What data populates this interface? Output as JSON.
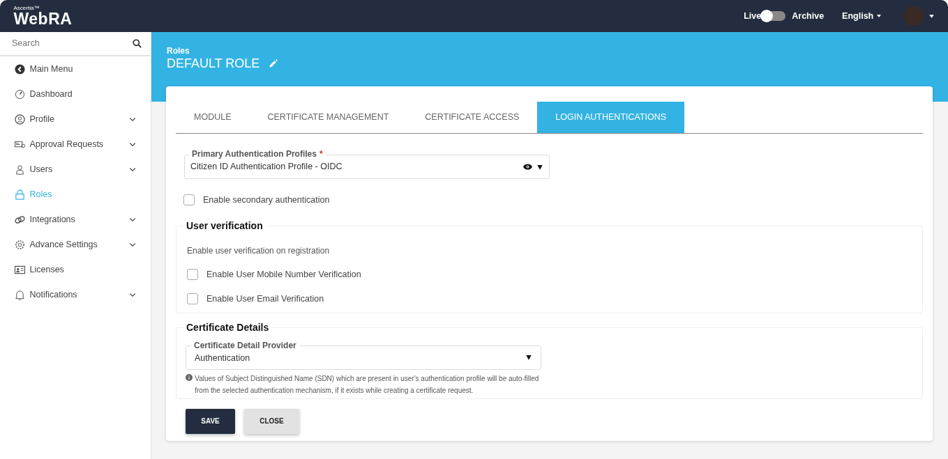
{
  "header": {
    "brand_small": "Ascertia™",
    "brand": "WebRA",
    "toggle": {
      "left_label": "Live",
      "right_label": "Archive",
      "on": false
    },
    "language": "English"
  },
  "sidebar": {
    "search": {
      "placeholder": "Search"
    },
    "items": [
      {
        "label": "Main Menu",
        "expandable": false,
        "selected": false
      },
      {
        "label": "Dashboard",
        "expandable": false,
        "selected": false
      },
      {
        "label": "Profile",
        "expandable": true,
        "selected": false
      },
      {
        "label": "Approval Requests",
        "expandable": true,
        "selected": false
      },
      {
        "label": "Users",
        "expandable": true,
        "selected": false
      },
      {
        "label": "Roles",
        "expandable": false,
        "selected": true
      },
      {
        "label": "Integrations",
        "expandable": true,
        "selected": false
      },
      {
        "label": "Advance Settings",
        "expandable": true,
        "selected": false
      },
      {
        "label": "Licenses",
        "expandable": false,
        "selected": false
      },
      {
        "label": "Notifications",
        "expandable": true,
        "selected": false
      }
    ]
  },
  "page": {
    "breadcrumb": "Roles",
    "title": "DEFAULT ROLE"
  },
  "tabs": [
    {
      "label": "MODULE",
      "selected": false
    },
    {
      "label": "CERTIFICATE MANAGEMENT",
      "selected": false
    },
    {
      "label": "CERTIFICATE ACCESS",
      "selected": false
    },
    {
      "label": "LOGIN AUTHENTICATIONS",
      "selected": true
    }
  ],
  "primary_auth": {
    "label": "Primary Authentication Profiles",
    "required_mark": "*",
    "value": "Citizen ID Authentication Profile - OIDC"
  },
  "secondary_auth": {
    "label": "Enable secondary authentication",
    "checked": false
  },
  "user_verification": {
    "title": "User verification",
    "description": "Enable user verification on registration",
    "options": [
      {
        "label": "Enable User Mobile Number Verification",
        "checked": false
      },
      {
        "label": "Enable User Email Verification",
        "checked": false
      }
    ]
  },
  "certificate_details": {
    "title": "Certificate Details",
    "provider": {
      "label": "Certificate Detail Provider",
      "value": "Authentication"
    },
    "note": "Values of Subject Distinguished Name (SDN) which are present in user's authentication profile will be auto-filled from the selected authentication mechanism, if it exists while creating a certificate request."
  },
  "buttons": [
    {
      "label": "SAVE",
      "kind": "primary"
    },
    {
      "label": "CLOSE",
      "kind": "secondary"
    }
  ]
}
